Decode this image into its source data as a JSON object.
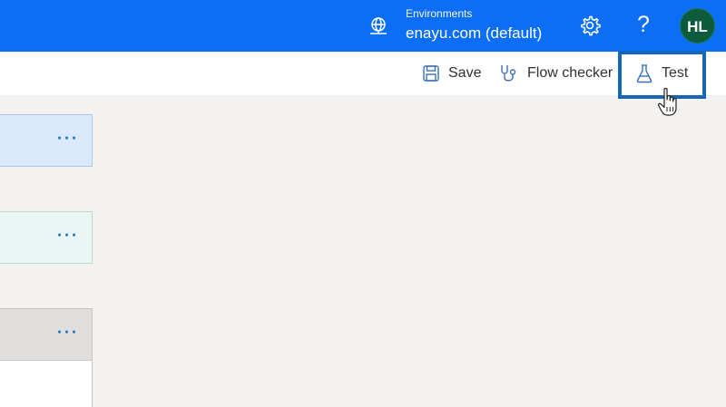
{
  "header": {
    "environments_label": "Environments",
    "environment_name": "enayu.com (default)",
    "help_label": "?",
    "avatar_initials": "HL",
    "background_color": "#0b6ef5"
  },
  "toolbar": {
    "save_label": "Save",
    "flow_checker_label": "Flow checker",
    "test_label": "Test",
    "highlight_color": "#1565b8"
  },
  "canvas": {
    "cards": [
      {
        "menu": "···",
        "color": "#dbe9fd"
      },
      {
        "menu": "···",
        "color": "#eaf6f3"
      },
      {
        "menu": "···",
        "color": "#e1dfdd"
      }
    ]
  }
}
